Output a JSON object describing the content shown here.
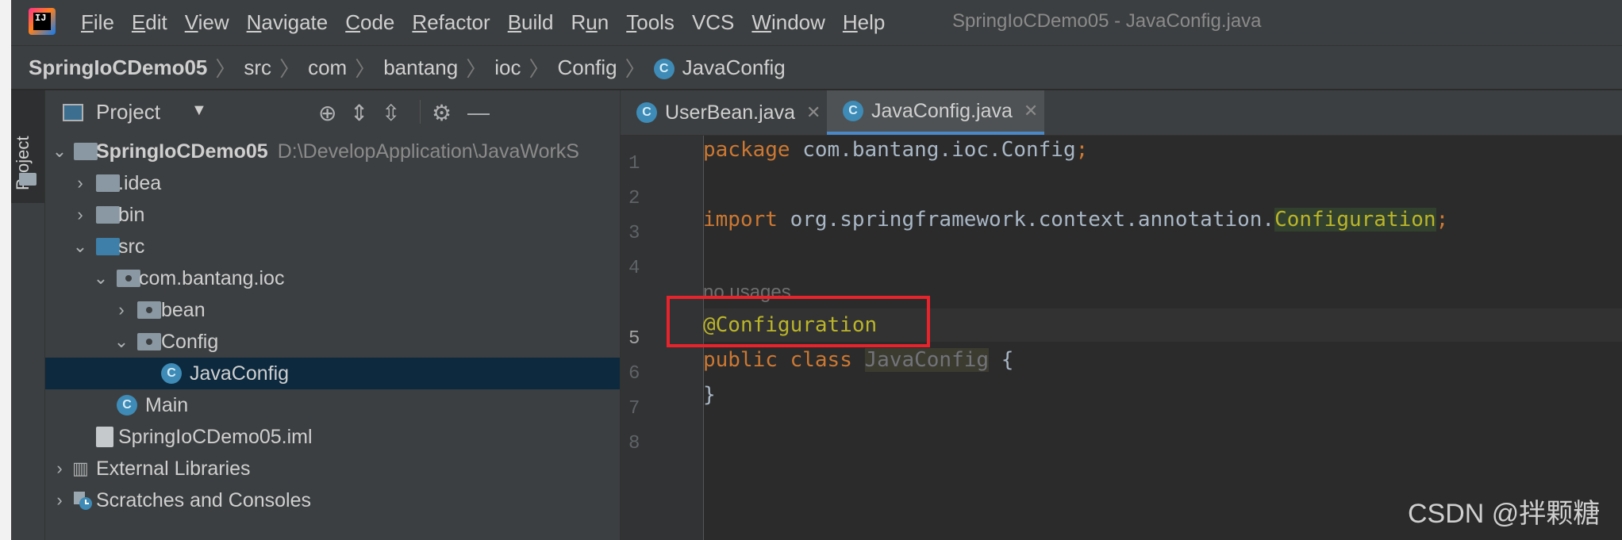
{
  "menu": {
    "items": [
      "File",
      "Edit",
      "View",
      "Navigate",
      "Code",
      "Refactor",
      "Build",
      "Run",
      "Tools",
      "VCS",
      "Window",
      "Help"
    ],
    "mnemonics": [
      "F",
      "E",
      "V",
      "N",
      "C",
      "R",
      "B",
      "u",
      "T",
      "",
      "W",
      "H"
    ]
  },
  "window_title": "SpringIoCDemo05 - JavaConfig.java",
  "breadcrumb": {
    "items": [
      "SpringIoCDemo05",
      "src",
      "com",
      "bantang",
      "ioc",
      "Config",
      "JavaConfig"
    ]
  },
  "tool_window": {
    "label": "Project"
  },
  "project_panel": {
    "title": "Project",
    "header_buttons": [
      "locate-icon",
      "expand-all-icon",
      "collapse-all-icon",
      "settings-icon",
      "hide-icon"
    ]
  },
  "tree": [
    {
      "label": "SpringIoCDemo05",
      "path": "D:\\DevelopApplication\\JavaWorkS",
      "bold": true
    },
    {
      "label": ".idea"
    },
    {
      "label": "bin"
    },
    {
      "label": "src"
    },
    {
      "label": "com.bantang.ioc"
    },
    {
      "label": "bean"
    },
    {
      "label": "Config"
    },
    {
      "label": "JavaConfig"
    },
    {
      "label": "Main"
    },
    {
      "label": "SpringIoCDemo05.iml"
    },
    {
      "label": "External Libraries"
    },
    {
      "label": "Scratches and Consoles"
    }
  ],
  "tabs": [
    {
      "label": "UserBean.java",
      "active": false
    },
    {
      "label": "JavaConfig.java",
      "active": true
    }
  ],
  "editor": {
    "line_numbers": [
      "1",
      "2",
      "3",
      "4",
      "5",
      "6",
      "7",
      "8"
    ],
    "inlay_hint": "no usages",
    "code": {
      "l1_kw": "package",
      "l1_rest": " com.bantang.ioc.Config",
      "l1_semi": ";",
      "l3_kw": "import",
      "l3_rest": " org.springframework.context.annotation.",
      "l3_hl": "Configuration",
      "l3_semi": ";",
      "l5_ann": "@Configuration",
      "l6_kw1": "public",
      "l6_kw2": "class",
      "l6_name": "JavaConfig",
      "l6_brace": "{",
      "l7_brace": "}"
    }
  },
  "watermark": "CSDN @拌颗糖",
  "colors": {
    "highlight_box": "#e8232b",
    "accent": "#4a88c7",
    "keyword": "#cc7832",
    "annotation": "#bbb529"
  }
}
